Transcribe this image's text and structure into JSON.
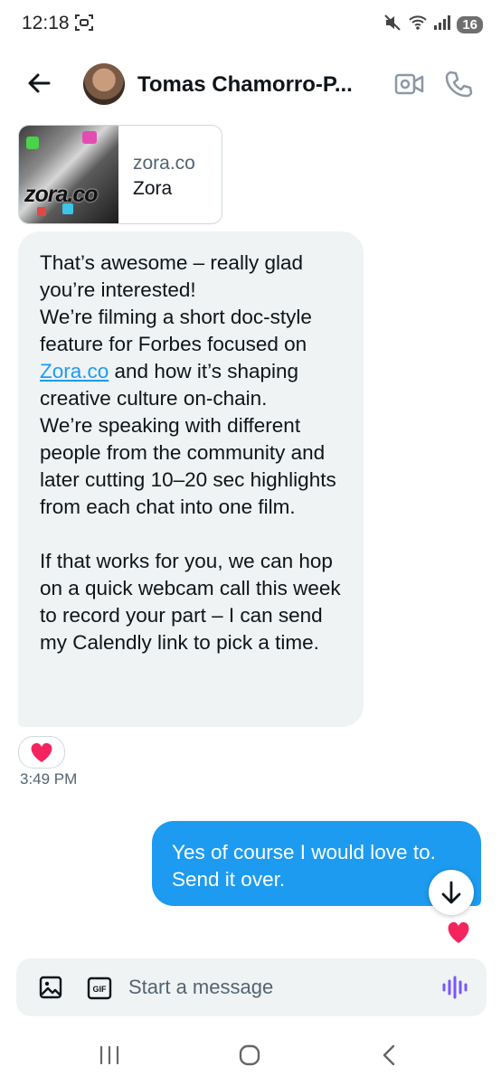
{
  "status_bar": {
    "time": "12:18",
    "battery": "16"
  },
  "header": {
    "contact_name": "Tomas Chamorro-P..."
  },
  "link_preview": {
    "thumb_text": "zora.co",
    "domain": "zora.co",
    "title": "Zora"
  },
  "received_message": {
    "text_before_link": "That’s awesome – really glad you’re interested!\nWe’re filming a short doc-style feature for Forbes focused on ",
    "link_text": "Zora.co",
    "text_after_link": " and how it’s shaping creative culture on-chain.\nWe’re speaking with different people from the community and later cutting 10–20 sec highlights from each chat into one film.\n\nIf that works for you, we can hop on a quick webcam call this week to record your part – I can send my Calendly link to pick a time.",
    "timestamp": "3:49 PM"
  },
  "sent_message": {
    "text": "Yes of course I would love to. Send it over."
  },
  "composer": {
    "placeholder": "Start a message",
    "gif_label": "GIF"
  },
  "colors": {
    "accent": "#1d9bf0",
    "bubble_received": "#eff3f4",
    "reaction_heart": "#f4245e",
    "voice_icon": "#7856ff"
  }
}
